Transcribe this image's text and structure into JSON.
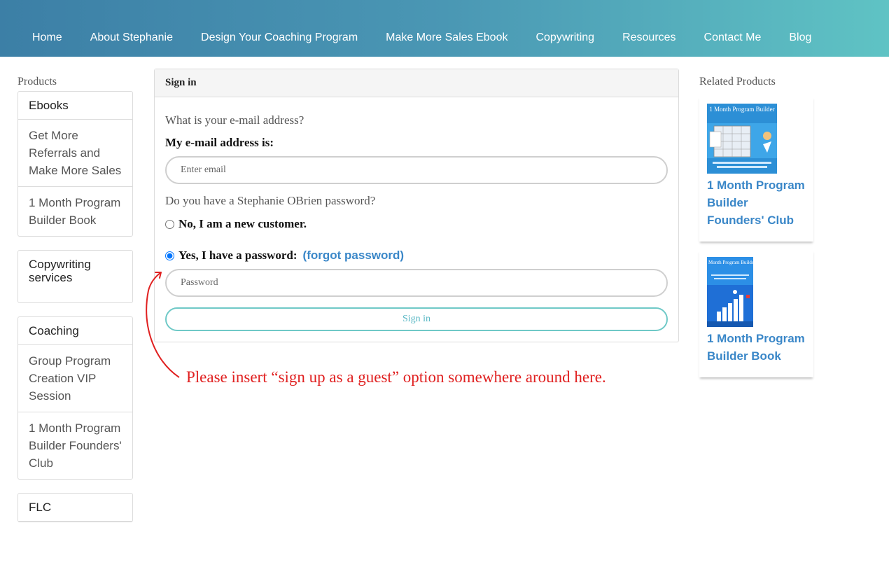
{
  "nav": {
    "items": [
      "Home",
      "About Stephanie",
      "Design Your Coaching Program",
      "Make More Sales Ebook",
      "Copywriting",
      "Resources",
      "Contact Me",
      "Blog"
    ]
  },
  "sidebar": {
    "title": "Products",
    "cards": [
      {
        "heading": "Ebooks",
        "items": [
          "Get More Referrals and Make More Sales",
          "1 Month Program Builder Book"
        ]
      },
      {
        "heading": "Copywriting services",
        "items": []
      },
      {
        "heading": "Coaching",
        "items": [
          "Group Program Creation VIP Session",
          "1 Month Program Builder Founders' Club"
        ]
      },
      {
        "heading": "FLC",
        "items": []
      }
    ]
  },
  "signin": {
    "header": "Sign in",
    "email_question": "What is your e-mail address?",
    "email_label": "My e-mail address is:",
    "email_placeholder": "Enter email",
    "email_value": "",
    "password_question": "Do you have a Stephanie OBrien password?",
    "new_customer_label": "No, I am a new customer.",
    "has_password_label": "Yes, I have a password:",
    "forgot_link": "(forgot password)",
    "password_placeholder": "Password",
    "password_value": "",
    "submit_label": "Sign in",
    "selected_option": "has_password"
  },
  "related": {
    "title": "Related Products",
    "products": [
      {
        "name": "1 Month Program Builder Founders' Club",
        "thumb_title": "1 Month Program Builder"
      },
      {
        "name": "1 Month Program Builder Book",
        "thumb_title": "1 Month Program Builder"
      }
    ]
  },
  "annotation": {
    "text": "Please insert “sign up as a guest” option somewhere around here.",
    "color": "#e02020"
  },
  "colors": {
    "header_start": "#3c7fa6",
    "header_end": "#5fc3c4",
    "link": "#3a87c8",
    "button_border": "#6fc9c7"
  }
}
